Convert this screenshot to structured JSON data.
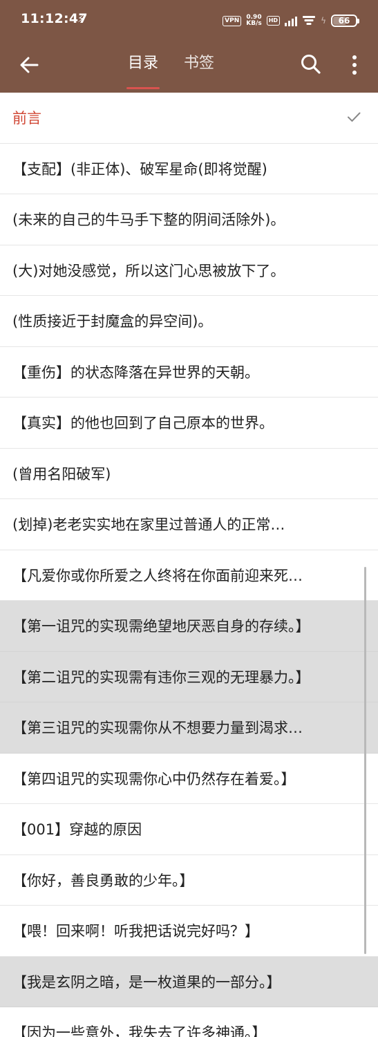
{
  "status": {
    "time": "11:12:47",
    "speed_top": "0.90",
    "speed_unit": "KB/s",
    "vpn": "VPN",
    "hd": "HD",
    "battery": "66"
  },
  "tabs": [
    {
      "label": "目录"
    },
    {
      "label": "书签"
    }
  ],
  "colors": {
    "bar": "#7d5645",
    "accent": "#d14836",
    "highlight": "#dddddd"
  },
  "chapters": [
    {
      "title": "前言"
    },
    {
      "title": "【支配】(非正体)、破军星命(即将觉醒)"
    },
    {
      "title": "(未来的自己的牛马手下整的阴间活除外)。"
    },
    {
      "title": "(大)对她没感觉，所以这门心思被放下了。"
    },
    {
      "title": "(性质接近于封魔盒的异空间)。"
    },
    {
      "title": "【重伤】的状态降落在异世界的天朝。"
    },
    {
      "title": "【真实】的他也回到了自己原本的世界。"
    },
    {
      "title": "(曾用名阳破军)"
    },
    {
      "title": "(划掉)老老实实地在家里过普通人的正常…"
    },
    {
      "title": "【凡爱你或你所爱之人终将在你面前迎来死…"
    },
    {
      "title": "【第一诅咒的实现需绝望地厌恶自身的存续。】"
    },
    {
      "title": "【第二诅咒的实现需有违你三观的无理暴力。】"
    },
    {
      "title": "【第三诅咒的实现需你从不想要力量到渴求…"
    },
    {
      "title": "【第四诅咒的实现需你心中仍然存在着爱。】"
    },
    {
      "title": "【001】穿越的原因"
    },
    {
      "title": "【你好，善良勇敢的少年。】"
    },
    {
      "title": "【喂！回来啊！听我把话说完好吗？】"
    },
    {
      "title": "【我是玄阴之暗，是一枚道果的一部分。】"
    },
    {
      "title": "【因为一些意外，我失去了许多神通。】"
    }
  ]
}
